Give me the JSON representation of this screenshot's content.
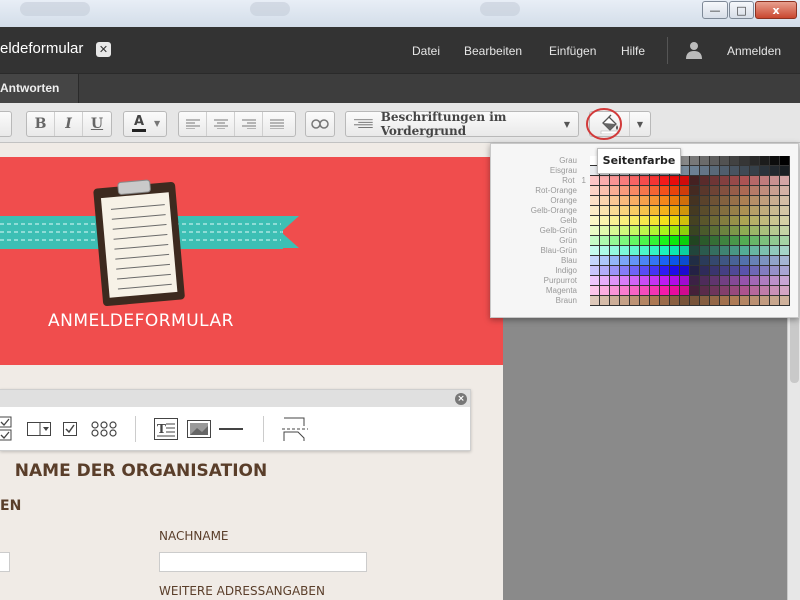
{
  "window": {
    "title": "eldeformular",
    "close_glyph": "✕",
    "minimize_glyph": "—",
    "maximize_glyph": "□",
    "win_close_glyph": "x"
  },
  "menu": {
    "items": [
      "Datei",
      "Bearbeiten",
      "Einfügen",
      "Hilfe"
    ],
    "signin": "Anmelden"
  },
  "tabs": {
    "active": "Antworten"
  },
  "toolbar": {
    "bold": "B",
    "italic": "I",
    "underline": "U",
    "text_color": "A",
    "label_position": "Beschriftungen im Vordergrund"
  },
  "document": {
    "banner_title": "ANMELDEFORMULAR",
    "organization": "NAME DER ORGANISATION",
    "section": "EN",
    "label_lastname": "NACHNAME",
    "label_address": "WEITERE ADRESSANGABEN"
  },
  "popup": {
    "tooltip": "Seitenfarbe",
    "color_names": [
      "Grau",
      "Eisgrau",
      "Rot",
      "Rot-Orange",
      "Orange",
      "Gelb-Orange",
      "Gelb",
      "Gelb-Grün",
      "Grün",
      "Blau-Grün",
      "Blau",
      "Indigo",
      "Purpurrot",
      "Magenta",
      "Braun"
    ],
    "red_index": "1"
  },
  "colors": {
    "banner": "#f04d4d",
    "ribbon": "#3dbfb4",
    "titlebar": "#333333",
    "text_brown": "#5a3e2a",
    "highlight_circle": "#d23a3a"
  }
}
